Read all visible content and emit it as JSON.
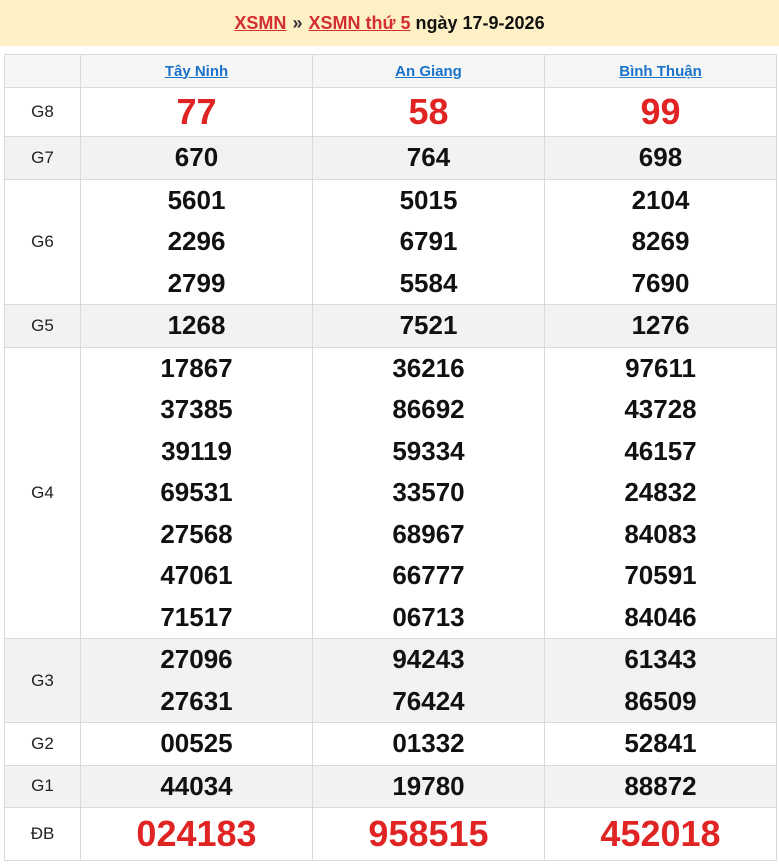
{
  "header": {
    "link1": "XSMN",
    "separator": "»",
    "link2": "XSMN thứ 5",
    "date": "ngày 17-9-2026"
  },
  "provinces": [
    "Tây Ninh",
    "An Giang",
    "Bình Thuận"
  ],
  "prizes": {
    "g8": {
      "label": "G8",
      "values": [
        [
          "77"
        ],
        [
          "58"
        ],
        [
          "99"
        ]
      ]
    },
    "g7": {
      "label": "G7",
      "values": [
        [
          "670"
        ],
        [
          "764"
        ],
        [
          "698"
        ]
      ]
    },
    "g6": {
      "label": "G6",
      "values": [
        [
          "5601",
          "2296",
          "2799"
        ],
        [
          "5015",
          "6791",
          "5584"
        ],
        [
          "2104",
          "8269",
          "7690"
        ]
      ]
    },
    "g5": {
      "label": "G5",
      "values": [
        [
          "1268"
        ],
        [
          "7521"
        ],
        [
          "1276"
        ]
      ]
    },
    "g4": {
      "label": "G4",
      "values": [
        [
          "17867",
          "37385",
          "39119",
          "69531",
          "27568",
          "47061",
          "71517"
        ],
        [
          "36216",
          "86692",
          "59334",
          "33570",
          "68967",
          "66777",
          "06713"
        ],
        [
          "97611",
          "43728",
          "46157",
          "24832",
          "84083",
          "70591",
          "84046"
        ]
      ]
    },
    "g3": {
      "label": "G3",
      "values": [
        [
          "27096",
          "27631"
        ],
        [
          "94243",
          "76424"
        ],
        [
          "61343",
          "86509"
        ]
      ]
    },
    "g2": {
      "label": "G2",
      "values": [
        [
          "00525"
        ],
        [
          "01332"
        ],
        [
          "52841"
        ]
      ]
    },
    "g1": {
      "label": "G1",
      "values": [
        [
          "44034"
        ],
        [
          "19780"
        ],
        [
          "88872"
        ]
      ]
    },
    "db": {
      "label": "ĐB",
      "values": [
        [
          "024183"
        ],
        [
          "958515"
        ],
        [
          "452018"
        ]
      ]
    }
  },
  "colors": {
    "header_bg": "#fdf0c5",
    "accent_red": "#e02424",
    "link_blue": "#1a73c9"
  }
}
